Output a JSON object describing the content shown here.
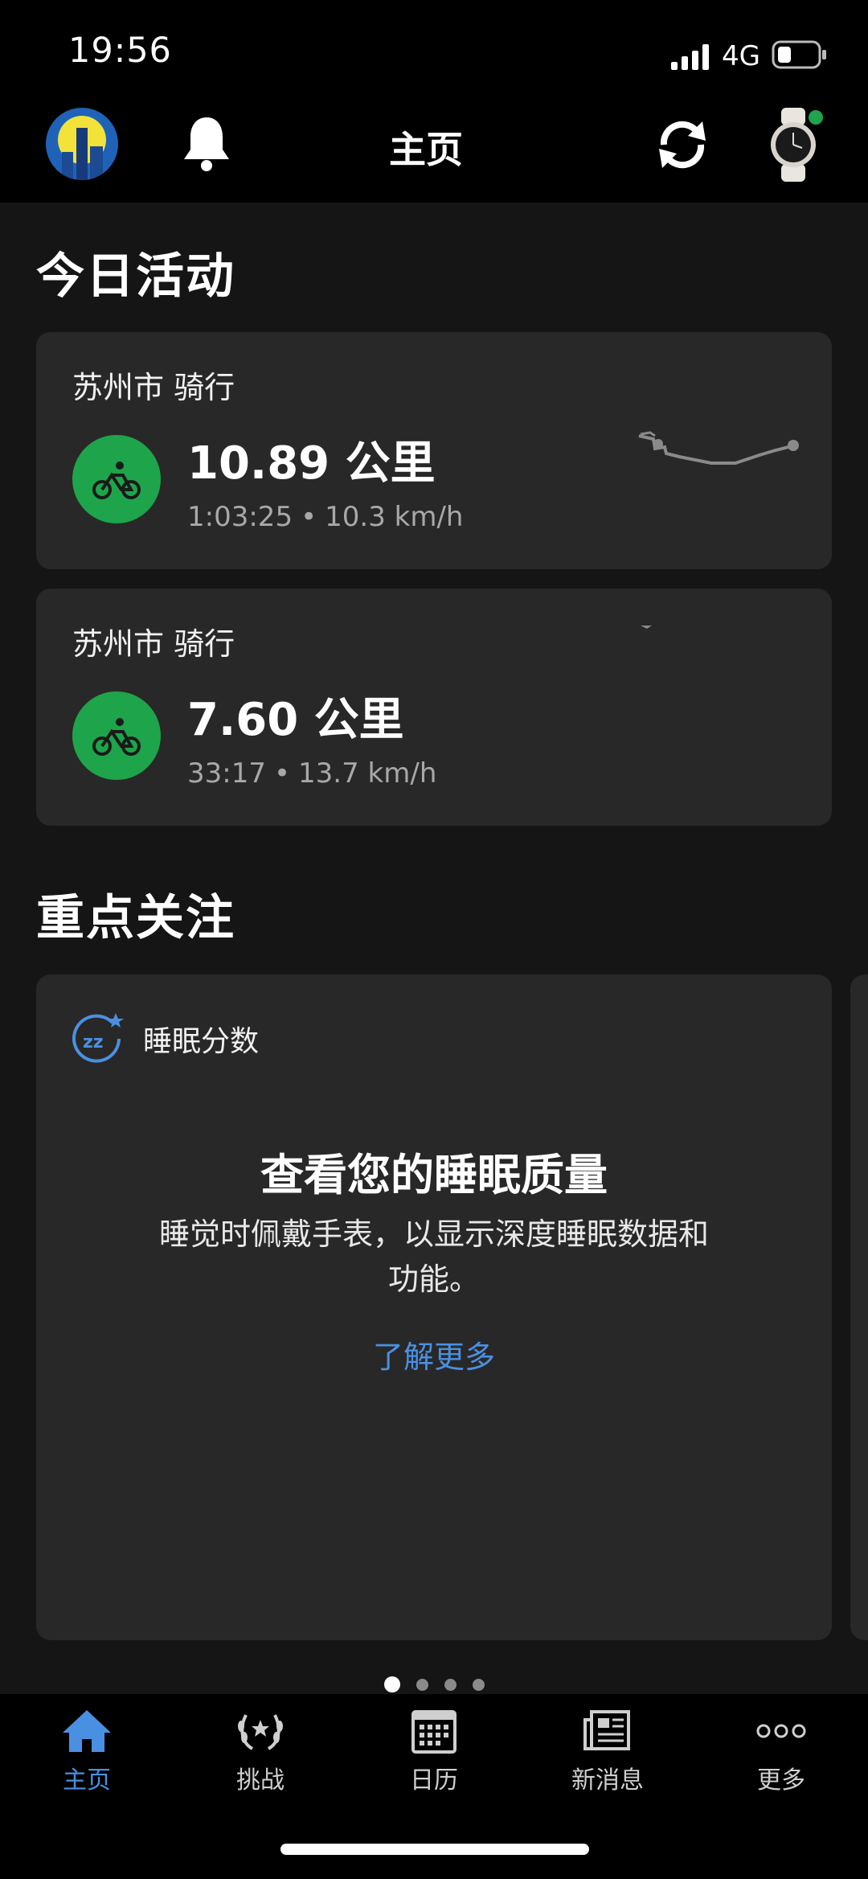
{
  "status_bar": {
    "time": "19:56",
    "network": "4G",
    "battery_percent": 35
  },
  "header": {
    "title": "主页",
    "icons": [
      "avatar",
      "bell-icon",
      "sync-icon",
      "watch-icon"
    ],
    "watch_connected_color": "#1ea44a"
  },
  "today": {
    "title": "今日活动",
    "activities": [
      {
        "location": "苏州市 骑行",
        "distance": "10.89 公里",
        "duration": "1:03:25",
        "speed": "10.3 km/h",
        "icon": "cycling-icon"
      },
      {
        "location": "苏州市 骑行",
        "distance": "7.60 公里",
        "duration": "33:17",
        "speed": "13.7 km/h",
        "icon": "cycling-icon"
      }
    ]
  },
  "focus": {
    "title": "重点关注",
    "card": {
      "label": "睡眠分数",
      "icon": "sleep-score-icon",
      "headline": "查看您的睡眠质量",
      "body": "睡觉时佩戴手表，以显示深度睡眠数据和功能。",
      "link": "了解更多"
    },
    "pages_total": 4,
    "pages_active": 1
  },
  "tabs": [
    {
      "label": "主页",
      "icon": "home-icon",
      "active": true
    },
    {
      "label": "挑战",
      "icon": "laurel-icon",
      "active": false
    },
    {
      "label": "日历",
      "icon": "calendar-icon",
      "active": false
    },
    {
      "label": "新消息",
      "icon": "news-icon",
      "active": false
    },
    {
      "label": "更多",
      "icon": "more-icon",
      "active": false
    }
  ],
  "colors": {
    "background": "#151515",
    "card": "#282828",
    "accent": "#4a90e2",
    "activity_green": "#1ea44a"
  }
}
